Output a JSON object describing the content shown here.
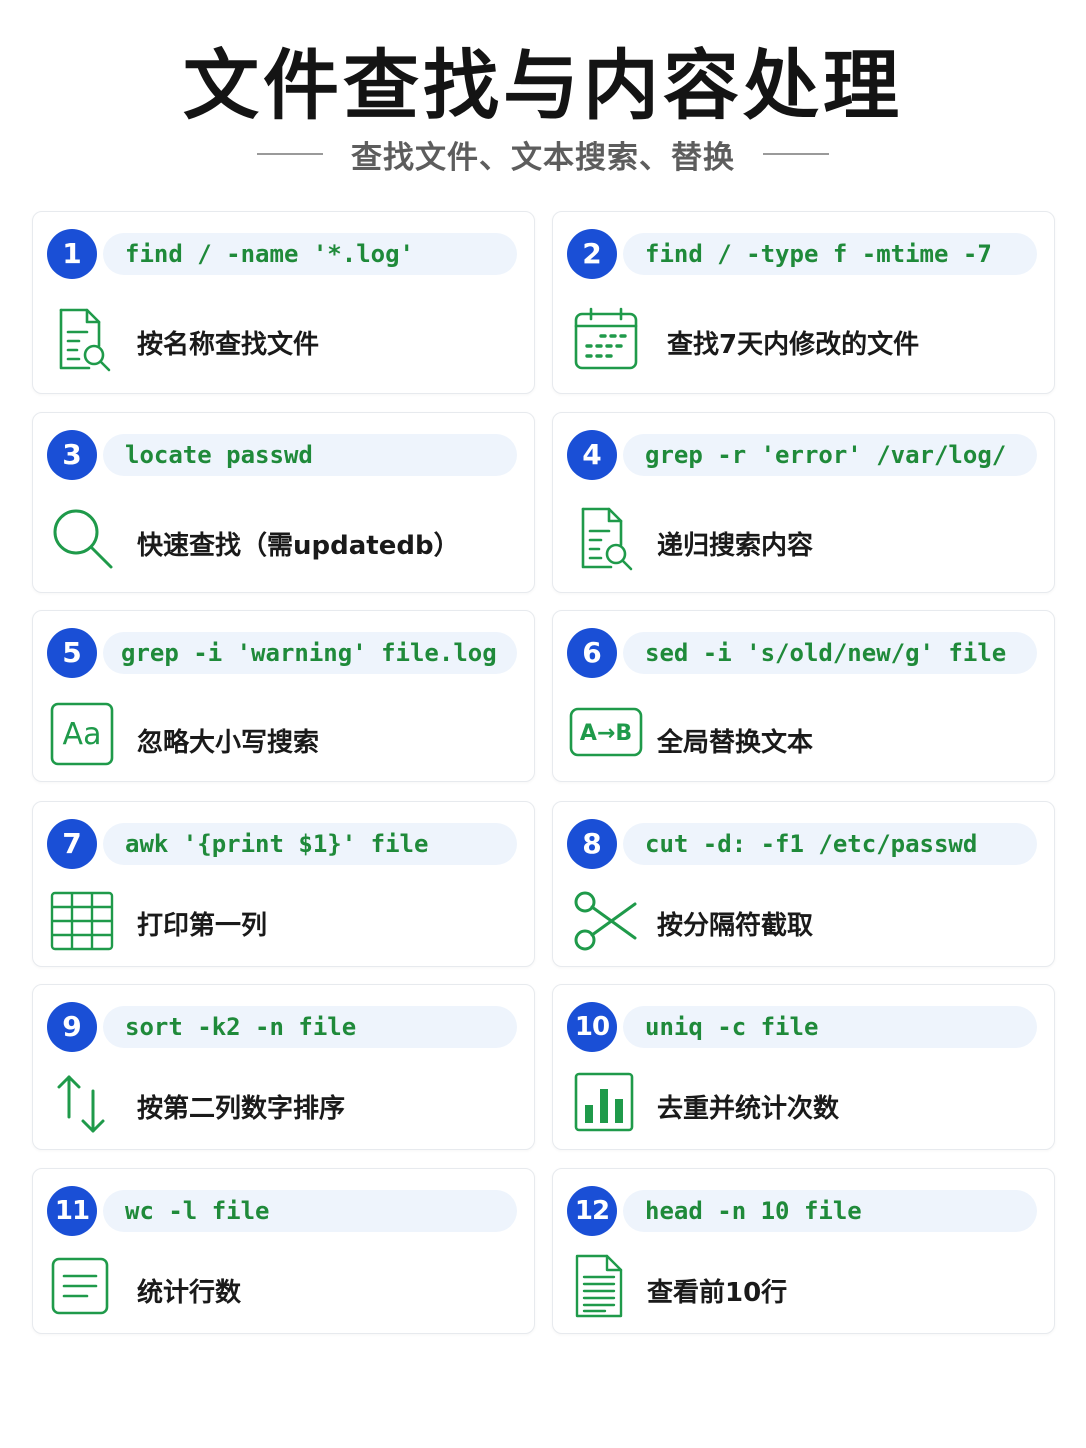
{
  "header": {
    "title": "文件查找与内容处理",
    "subtitle": "查找文件、文本搜索、替换"
  },
  "colors": {
    "badge": "#1a4fd6",
    "command_text": "#1f8a3a",
    "command_bg": "#eef4fc",
    "icon_stroke": "#1f9a4a"
  },
  "cards": [
    {
      "number": "1",
      "command": "find / -name '*.log'",
      "description": "按名称查找文件",
      "icon": "file-search-icon"
    },
    {
      "number": "2",
      "command": "find / -type f -mtime -7",
      "description": "查找7天内修改的文件",
      "icon": "calendar-icon"
    },
    {
      "number": "3",
      "command": "locate passwd",
      "description": "快速查找（需updatedb）",
      "icon": "magnifier-icon"
    },
    {
      "number": "4",
      "command": "grep -r 'error' /var/log/",
      "description": "递归搜索内容",
      "icon": "file-search-icon"
    },
    {
      "number": "5",
      "command": "grep -i 'warning' file.log",
      "description": "忽略大小写搜索",
      "icon": "case-aa-icon"
    },
    {
      "number": "6",
      "command": "sed -i 's/old/new/g' file",
      "description": "全局替换文本",
      "icon": "replace-a-to-b-icon"
    },
    {
      "number": "7",
      "command": "awk '{print $1}' file",
      "description": "打印第一列",
      "icon": "table-icon"
    },
    {
      "number": "8",
      "command": "cut -d: -f1 /etc/passwd",
      "description": "按分隔符截取",
      "icon": "scissors-icon"
    },
    {
      "number": "9",
      "command": "sort -k2 -n file",
      "description": "按第二列数字排序",
      "icon": "sort-arrows-icon"
    },
    {
      "number": "10",
      "command": "uniq -c file",
      "description": "去重并统计次数",
      "icon": "bar-chart-icon"
    },
    {
      "number": "11",
      "command": "wc -l file",
      "description": "统计行数",
      "icon": "lines-doc-icon"
    },
    {
      "number": "12",
      "command": "head -n 10 file",
      "description": "查看前10行",
      "icon": "text-page-icon"
    }
  ]
}
